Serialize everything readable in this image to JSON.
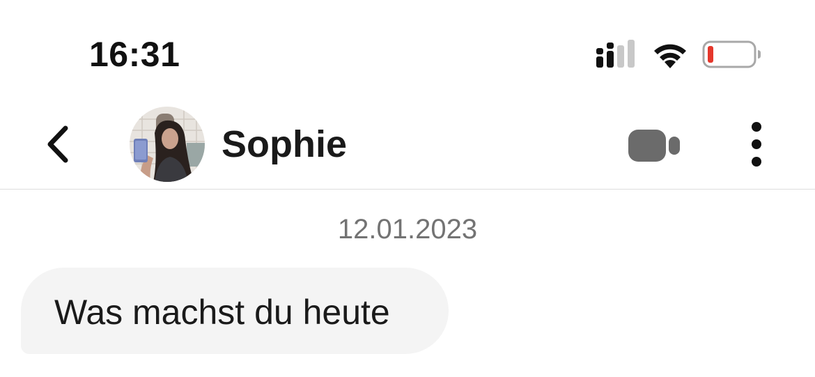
{
  "status_bar": {
    "time": "16:31",
    "signal_icon": "cellular-signal-icon",
    "wifi_icon": "wifi-icon",
    "battery_icon": "battery-low-icon",
    "battery_level": 0.1,
    "battery_color": "#e5372b"
  },
  "header": {
    "back_icon": "chevron-left-icon",
    "contact_name": "Sophie",
    "avatar_icon": "contact-photo-avatar",
    "video_icon": "video-camera-icon",
    "more_icon": "vertical-ellipsis-icon",
    "video_icon_color": "#6b6b6b"
  },
  "conversation": {
    "date": "12.01.2023",
    "messages": [
      {
        "direction": "incoming",
        "text": "Was machst du heute",
        "bubble_color": "#f4f4f4"
      }
    ]
  }
}
